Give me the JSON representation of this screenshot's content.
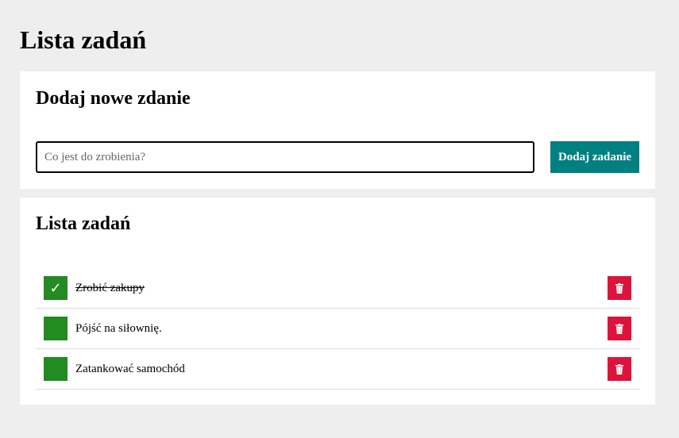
{
  "page": {
    "title": "Lista zadań"
  },
  "add_section": {
    "heading": "Dodaj nowe zdanie",
    "input_placeholder": "Co jest do zrobienia?",
    "input_value": "",
    "button_label": "Dodaj zadanie"
  },
  "list_section": {
    "heading": "Lista zadań",
    "tasks": [
      {
        "text": "Zrobić zakupy",
        "done": true,
        "check_icon": "checkmark-icon",
        "delete_icon": "trash-icon"
      },
      {
        "text": "Pójść na siłownię.",
        "done": false,
        "check_icon": "checkmark-icon",
        "delete_icon": "trash-icon"
      },
      {
        "text": "Zatankować samochód",
        "done": false,
        "check_icon": "checkmark-icon",
        "delete_icon": "trash-icon"
      }
    ]
  },
  "colors": {
    "background": "#eeeeee",
    "card": "#ffffff",
    "add_button": "#008080",
    "check_box": "#228b22",
    "delete_button": "#dc143c",
    "divider": "#dddddd"
  },
  "glyphs": {
    "check": "✓"
  }
}
